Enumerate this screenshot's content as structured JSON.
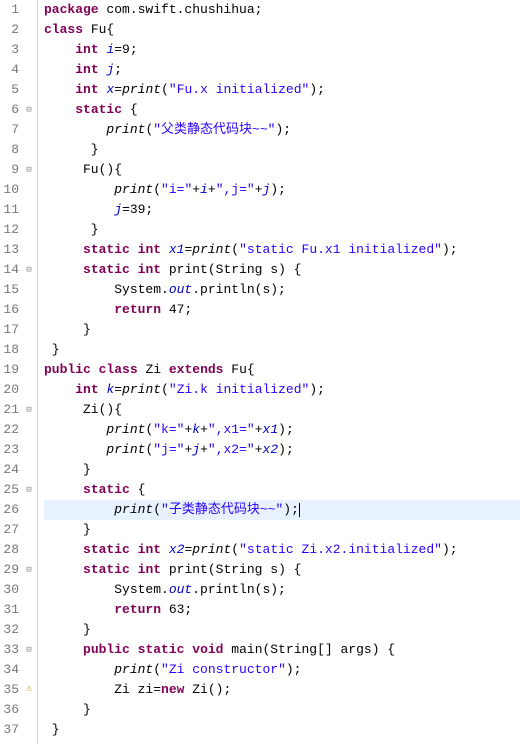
{
  "highlight_line": 26,
  "lines": [
    {
      "num": 1,
      "fold": false,
      "warn": false,
      "tokens": [
        {
          "t": "kw",
          "v": "package"
        },
        {
          "t": "plain",
          "v": " com.swift.chushihua;"
        }
      ]
    },
    {
      "num": 2,
      "fold": false,
      "warn": false,
      "tokens": [
        {
          "t": "kw",
          "v": "class"
        },
        {
          "t": "plain",
          "v": " Fu{"
        }
      ]
    },
    {
      "num": 3,
      "fold": false,
      "warn": false,
      "tokens": [
        {
          "t": "plain",
          "v": "    "
        },
        {
          "t": "kw",
          "v": "int"
        },
        {
          "t": "plain",
          "v": " "
        },
        {
          "t": "fld",
          "v": "i"
        },
        {
          "t": "plain",
          "v": "=9;"
        }
      ]
    },
    {
      "num": 4,
      "fold": false,
      "warn": false,
      "tokens": [
        {
          "t": "plain",
          "v": "    "
        },
        {
          "t": "kw",
          "v": "int"
        },
        {
          "t": "plain",
          "v": " "
        },
        {
          "t": "fld",
          "v": "j"
        },
        {
          "t": "plain",
          "v": ";"
        }
      ]
    },
    {
      "num": 5,
      "fold": false,
      "warn": false,
      "tokens": [
        {
          "t": "plain",
          "v": "    "
        },
        {
          "t": "kw",
          "v": "int"
        },
        {
          "t": "plain",
          "v": " "
        },
        {
          "t": "fld",
          "v": "x"
        },
        {
          "t": "plain",
          "v": "="
        },
        {
          "t": "it",
          "v": "print"
        },
        {
          "t": "plain",
          "v": "("
        },
        {
          "t": "str",
          "v": "\"Fu.x initialized\""
        },
        {
          "t": "plain",
          "v": ");"
        }
      ]
    },
    {
      "num": 6,
      "fold": true,
      "warn": false,
      "tokens": [
        {
          "t": "plain",
          "v": "    "
        },
        {
          "t": "kw",
          "v": "static"
        },
        {
          "t": "plain",
          "v": " {"
        }
      ]
    },
    {
      "num": 7,
      "fold": false,
      "warn": false,
      "tokens": [
        {
          "t": "plain",
          "v": "        "
        },
        {
          "t": "it",
          "v": "print"
        },
        {
          "t": "plain",
          "v": "("
        },
        {
          "t": "str",
          "v": "\"父类静态代码块~~\""
        },
        {
          "t": "plain",
          "v": ");"
        }
      ]
    },
    {
      "num": 8,
      "fold": false,
      "warn": false,
      "tokens": [
        {
          "t": "plain",
          "v": "      }"
        }
      ]
    },
    {
      "num": 9,
      "fold": true,
      "warn": false,
      "tokens": [
        {
          "t": "plain",
          "v": "     Fu(){"
        }
      ]
    },
    {
      "num": 10,
      "fold": false,
      "warn": false,
      "tokens": [
        {
          "t": "plain",
          "v": "         "
        },
        {
          "t": "it",
          "v": "print"
        },
        {
          "t": "plain",
          "v": "("
        },
        {
          "t": "str",
          "v": "\"i=\""
        },
        {
          "t": "plain",
          "v": "+"
        },
        {
          "t": "fld",
          "v": "i"
        },
        {
          "t": "plain",
          "v": "+"
        },
        {
          "t": "str",
          "v": "\",j=\""
        },
        {
          "t": "plain",
          "v": "+"
        },
        {
          "t": "fld",
          "v": "j"
        },
        {
          "t": "plain",
          "v": ");"
        }
      ]
    },
    {
      "num": 11,
      "fold": false,
      "warn": false,
      "tokens": [
        {
          "t": "plain",
          "v": "         "
        },
        {
          "t": "fld",
          "v": "j"
        },
        {
          "t": "plain",
          "v": "=39;"
        }
      ]
    },
    {
      "num": 12,
      "fold": false,
      "warn": false,
      "tokens": [
        {
          "t": "plain",
          "v": "      }"
        }
      ]
    },
    {
      "num": 13,
      "fold": false,
      "warn": false,
      "tokens": [
        {
          "t": "plain",
          "v": "     "
        },
        {
          "t": "kw",
          "v": "static"
        },
        {
          "t": "plain",
          "v": " "
        },
        {
          "t": "kw",
          "v": "int"
        },
        {
          "t": "plain",
          "v": " "
        },
        {
          "t": "sfld",
          "v": "x1"
        },
        {
          "t": "plain",
          "v": "="
        },
        {
          "t": "it",
          "v": "print"
        },
        {
          "t": "plain",
          "v": "("
        },
        {
          "t": "str",
          "v": "\"static Fu.x1 initialized\""
        },
        {
          "t": "plain",
          "v": ");"
        }
      ]
    },
    {
      "num": 14,
      "fold": true,
      "warn": false,
      "tokens": [
        {
          "t": "plain",
          "v": "     "
        },
        {
          "t": "kw",
          "v": "static"
        },
        {
          "t": "plain",
          "v": " "
        },
        {
          "t": "kw",
          "v": "int"
        },
        {
          "t": "plain",
          "v": " print(String s) {"
        }
      ]
    },
    {
      "num": 15,
      "fold": false,
      "warn": false,
      "tokens": [
        {
          "t": "plain",
          "v": "         System."
        },
        {
          "t": "sfld",
          "v": "out"
        },
        {
          "t": "plain",
          "v": ".println(s);"
        }
      ]
    },
    {
      "num": 16,
      "fold": false,
      "warn": false,
      "tokens": [
        {
          "t": "plain",
          "v": "         "
        },
        {
          "t": "kw",
          "v": "return"
        },
        {
          "t": "plain",
          "v": " 47;"
        }
      ]
    },
    {
      "num": 17,
      "fold": false,
      "warn": false,
      "tokens": [
        {
          "t": "plain",
          "v": "     }"
        }
      ]
    },
    {
      "num": 18,
      "fold": false,
      "warn": false,
      "tokens": [
        {
          "t": "plain",
          "v": " }"
        }
      ]
    },
    {
      "num": 19,
      "fold": false,
      "warn": false,
      "tokens": [
        {
          "t": "kw",
          "v": "public"
        },
        {
          "t": "plain",
          "v": " "
        },
        {
          "t": "kw",
          "v": "class"
        },
        {
          "t": "plain",
          "v": " Zi "
        },
        {
          "t": "kw",
          "v": "extends"
        },
        {
          "t": "plain",
          "v": " Fu{"
        }
      ]
    },
    {
      "num": 20,
      "fold": false,
      "warn": false,
      "tokens": [
        {
          "t": "plain",
          "v": "    "
        },
        {
          "t": "kw",
          "v": "int"
        },
        {
          "t": "plain",
          "v": " "
        },
        {
          "t": "fld",
          "v": "k"
        },
        {
          "t": "plain",
          "v": "="
        },
        {
          "t": "it",
          "v": "print"
        },
        {
          "t": "plain",
          "v": "("
        },
        {
          "t": "str",
          "v": "\"Zi.k initialized\""
        },
        {
          "t": "plain",
          "v": ");"
        }
      ]
    },
    {
      "num": 21,
      "fold": true,
      "warn": false,
      "tokens": [
        {
          "t": "plain",
          "v": "     Zi(){"
        }
      ]
    },
    {
      "num": 22,
      "fold": false,
      "warn": false,
      "tokens": [
        {
          "t": "plain",
          "v": "        "
        },
        {
          "t": "it",
          "v": "print"
        },
        {
          "t": "plain",
          "v": "("
        },
        {
          "t": "str",
          "v": "\"k=\""
        },
        {
          "t": "plain",
          "v": "+"
        },
        {
          "t": "fld",
          "v": "k"
        },
        {
          "t": "plain",
          "v": "+"
        },
        {
          "t": "str",
          "v": "\",x1=\""
        },
        {
          "t": "plain",
          "v": "+"
        },
        {
          "t": "sfld",
          "v": "x1"
        },
        {
          "t": "plain",
          "v": ");"
        }
      ]
    },
    {
      "num": 23,
      "fold": false,
      "warn": false,
      "tokens": [
        {
          "t": "plain",
          "v": "        "
        },
        {
          "t": "it",
          "v": "print"
        },
        {
          "t": "plain",
          "v": "("
        },
        {
          "t": "str",
          "v": "\"j=\""
        },
        {
          "t": "plain",
          "v": "+"
        },
        {
          "t": "fld",
          "v": "j"
        },
        {
          "t": "plain",
          "v": "+"
        },
        {
          "t": "str",
          "v": "\",x2=\""
        },
        {
          "t": "plain",
          "v": "+"
        },
        {
          "t": "sfld",
          "v": "x2"
        },
        {
          "t": "plain",
          "v": ");"
        }
      ]
    },
    {
      "num": 24,
      "fold": false,
      "warn": false,
      "tokens": [
        {
          "t": "plain",
          "v": "     }"
        }
      ]
    },
    {
      "num": 25,
      "fold": true,
      "warn": false,
      "tokens": [
        {
          "t": "plain",
          "v": "     "
        },
        {
          "t": "kw",
          "v": "static"
        },
        {
          "t": "plain",
          "v": " {"
        }
      ]
    },
    {
      "num": 26,
      "fold": false,
      "warn": false,
      "tokens": [
        {
          "t": "plain",
          "v": "         "
        },
        {
          "t": "it",
          "v": "print"
        },
        {
          "t": "plain",
          "v": "("
        },
        {
          "t": "str",
          "v": "\"子类静态代码块~~\""
        },
        {
          "t": "plain",
          "v": ");"
        }
      ]
    },
    {
      "num": 27,
      "fold": false,
      "warn": false,
      "tokens": [
        {
          "t": "plain",
          "v": "     }"
        }
      ]
    },
    {
      "num": 28,
      "fold": false,
      "warn": false,
      "tokens": [
        {
          "t": "plain",
          "v": "     "
        },
        {
          "t": "kw",
          "v": "static"
        },
        {
          "t": "plain",
          "v": " "
        },
        {
          "t": "kw",
          "v": "int"
        },
        {
          "t": "plain",
          "v": " "
        },
        {
          "t": "sfld",
          "v": "x2"
        },
        {
          "t": "plain",
          "v": "="
        },
        {
          "t": "it",
          "v": "print"
        },
        {
          "t": "plain",
          "v": "("
        },
        {
          "t": "str",
          "v": "\"static Zi.x2.initialized\""
        },
        {
          "t": "plain",
          "v": ");"
        }
      ]
    },
    {
      "num": 29,
      "fold": true,
      "warn": false,
      "tokens": [
        {
          "t": "plain",
          "v": "     "
        },
        {
          "t": "kw",
          "v": "static"
        },
        {
          "t": "plain",
          "v": " "
        },
        {
          "t": "kw",
          "v": "int"
        },
        {
          "t": "plain",
          "v": " print(String s) {"
        }
      ]
    },
    {
      "num": 30,
      "fold": false,
      "warn": false,
      "tokens": [
        {
          "t": "plain",
          "v": "         System."
        },
        {
          "t": "sfld",
          "v": "out"
        },
        {
          "t": "plain",
          "v": ".println(s);"
        }
      ]
    },
    {
      "num": 31,
      "fold": false,
      "warn": false,
      "tokens": [
        {
          "t": "plain",
          "v": "         "
        },
        {
          "t": "kw",
          "v": "return"
        },
        {
          "t": "plain",
          "v": " 63;"
        }
      ]
    },
    {
      "num": 32,
      "fold": false,
      "warn": false,
      "tokens": [
        {
          "t": "plain",
          "v": "     }"
        }
      ]
    },
    {
      "num": 33,
      "fold": true,
      "warn": false,
      "tokens": [
        {
          "t": "plain",
          "v": "     "
        },
        {
          "t": "kw",
          "v": "public"
        },
        {
          "t": "plain",
          "v": " "
        },
        {
          "t": "kw",
          "v": "static"
        },
        {
          "t": "plain",
          "v": " "
        },
        {
          "t": "kw",
          "v": "void"
        },
        {
          "t": "plain",
          "v": " main(String[] args) {"
        }
      ]
    },
    {
      "num": 34,
      "fold": false,
      "warn": false,
      "tokens": [
        {
          "t": "plain",
          "v": "         "
        },
        {
          "t": "it",
          "v": "print"
        },
        {
          "t": "plain",
          "v": "("
        },
        {
          "t": "str",
          "v": "\"Zi constructor\""
        },
        {
          "t": "plain",
          "v": ");"
        }
      ]
    },
    {
      "num": 35,
      "fold": false,
      "warn": true,
      "tokens": [
        {
          "t": "plain",
          "v": "         Zi zi="
        },
        {
          "t": "kw",
          "v": "new"
        },
        {
          "t": "plain",
          "v": " Zi();"
        }
      ]
    },
    {
      "num": 36,
      "fold": false,
      "warn": false,
      "tokens": [
        {
          "t": "plain",
          "v": "     }"
        }
      ]
    },
    {
      "num": 37,
      "fold": false,
      "warn": false,
      "tokens": [
        {
          "t": "plain",
          "v": " }"
        }
      ]
    }
  ]
}
